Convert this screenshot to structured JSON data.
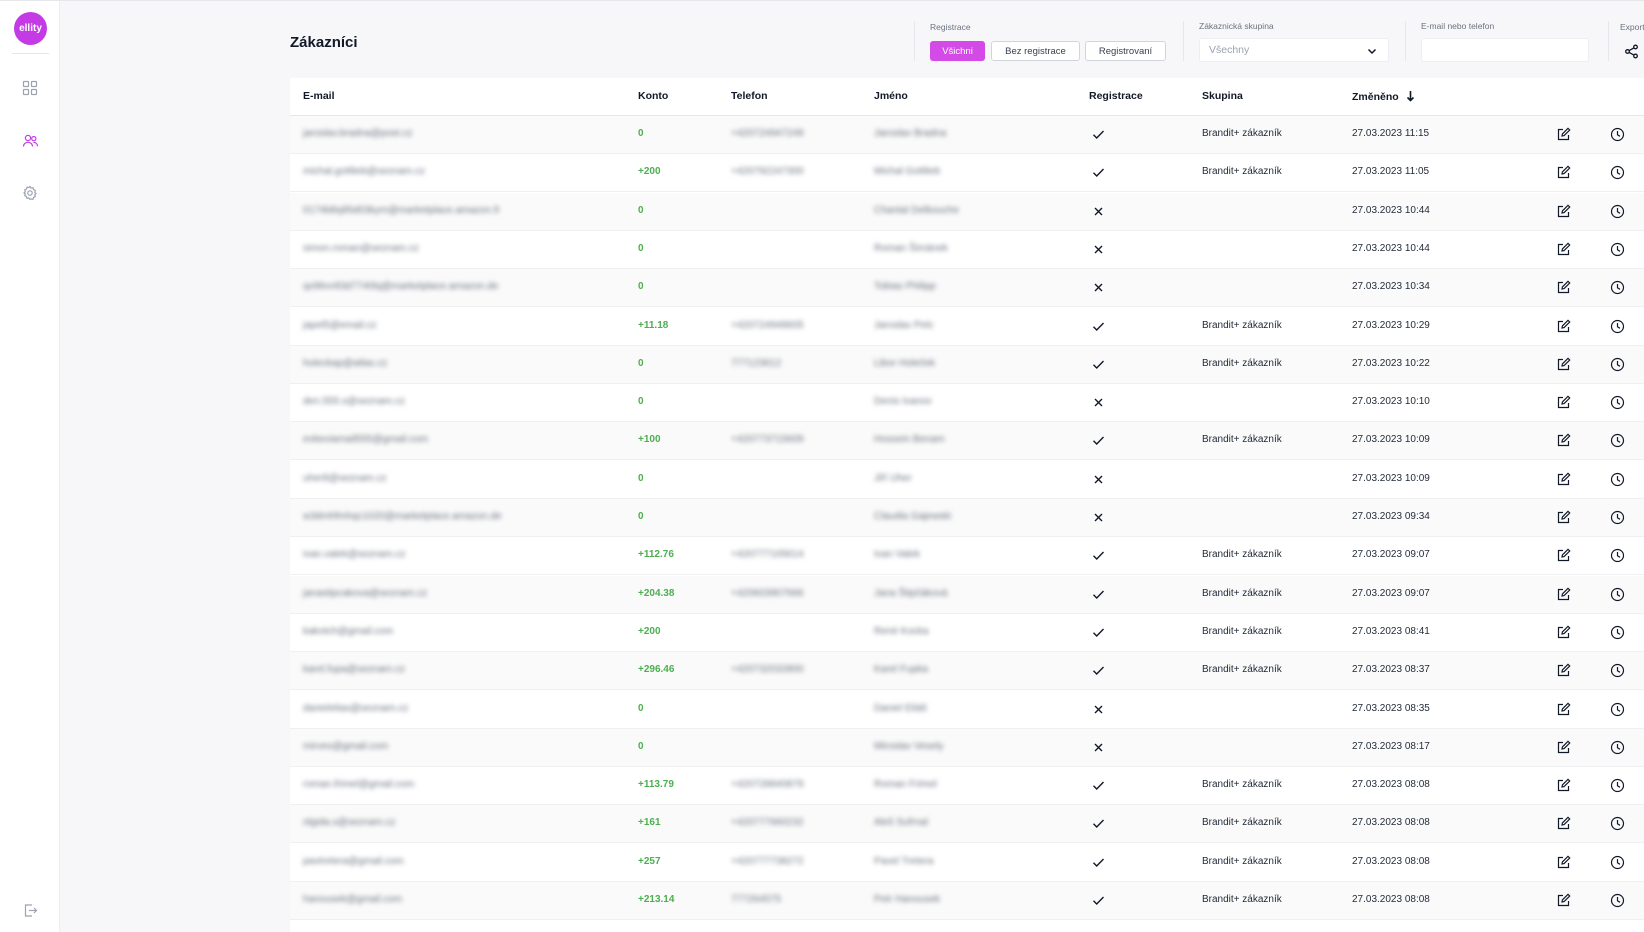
{
  "app": {
    "logo_text": "ellity",
    "accent": "#d44ae6"
  },
  "sidebar": {
    "items": [
      {
        "name": "dashboard",
        "icon": "grid-icon"
      },
      {
        "name": "customers",
        "icon": "users-icon",
        "active": true
      },
      {
        "name": "settings",
        "icon": "gear-icon"
      }
    ],
    "logout_icon": "logout-icon"
  },
  "header": {
    "title": "Zákazníci",
    "registration_filter": {
      "label": "Registrace",
      "options": [
        "Všichni",
        "Bez registrace",
        "Registrovaní"
      ],
      "selected": "Všichni"
    },
    "group_filter": {
      "label": "Zákaznická skupina",
      "selected": "Všechny"
    },
    "search": {
      "label": "E-mail nebo telefon",
      "value": ""
    },
    "export": {
      "label": "Export"
    }
  },
  "table": {
    "columns": [
      "E-mail",
      "Konto",
      "Telefon",
      "Jméno",
      "Registrace",
      "Skupina",
      "Změněno"
    ],
    "sort": {
      "column": "Změněno",
      "direction": "desc"
    },
    "rows": [
      {
        "email": "jaroslav.bradna@post.cz",
        "konto": "0",
        "telefon": "+420724947249",
        "jmeno": "Jaroslav Bradna",
        "registrace": true,
        "skupina": "Brandit+ zákazník",
        "zmeneno": "27.03.2023 11:15"
      },
      {
        "email": "michal.gottlieb@seznam.cz",
        "konto": "+200",
        "telefon": "+420792247300",
        "jmeno": "Michal Gottlieb",
        "registrace": true,
        "skupina": "Brandit+ zákazník",
        "zmeneno": "27.03.2023 11:05"
      },
      {
        "email": "0174b8q95d03kym@marketplace.amazon.fr",
        "konto": "0",
        "telefon": "",
        "jmeno": "Chantal Delbouche",
        "registrace": false,
        "skupina": "",
        "zmeneno": "27.03.2023 10:44"
      },
      {
        "email": "simon.roman@seznam.cz",
        "konto": "0",
        "telefon": "",
        "jmeno": "Roman Šimánek",
        "registrace": false,
        "skupina": "",
        "zmeneno": "27.03.2023 10:44"
      },
      {
        "email": "qx96vv93d7740lq@marketplace.amazon.de",
        "konto": "0",
        "telefon": "",
        "jmeno": "Tobias Philipp",
        "registrace": false,
        "skupina": "",
        "zmeneno": "27.03.2023 10:34"
      },
      {
        "email": "japel5@email.cz",
        "konto": "+11.18",
        "telefon": "+420724948605",
        "jmeno": "Jaroslav Pelc",
        "registrace": true,
        "skupina": "Brandit+ zákazník",
        "zmeneno": "27.03.2023 10:29"
      },
      {
        "email": "holeckap@atlas.cz",
        "konto": "0",
        "telefon": "777123612",
        "jmeno": "Libor Holeček",
        "registrace": true,
        "skupina": "Brandit+ zákazník",
        "zmeneno": "27.03.2023 10:22"
      },
      {
        "email": "den.555.s@seznam.cz",
        "konto": "0",
        "telefon": "",
        "jmeno": "Denis Ivanov",
        "registrace": false,
        "skupina": "",
        "zmeneno": "27.03.2023 10:10"
      },
      {
        "email": "evbeviamail555@gmail.com",
        "konto": "+100",
        "telefon": "+420773715609",
        "jmeno": "Hossein Benam",
        "registrace": true,
        "skupina": "Brandit+ zákazník",
        "zmeneno": "27.03.2023 10:09"
      },
      {
        "email": "uher8@seznam.cz",
        "konto": "0",
        "telefon": "",
        "jmeno": "Jiří Uher",
        "registrace": false,
        "skupina": "",
        "zmeneno": "27.03.2023 10:09"
      },
      {
        "email": "w3dmhfmhqc1020@marketplace.amazon.de",
        "konto": "0",
        "telefon": "",
        "jmeno": "Claudia Gajewski",
        "registrace": false,
        "skupina": "",
        "zmeneno": "27.03.2023 09:34"
      },
      {
        "email": "ivan.valek@seznam.cz",
        "konto": "+112.76",
        "telefon": "+420777105614",
        "jmeno": "Ivan Valek",
        "registrace": true,
        "skupina": "Brandit+ zákazník",
        "zmeneno": "27.03.2023 09:07"
      },
      {
        "email": "janastipcakova@seznam.cz",
        "konto": "+204.38",
        "telefon": "+420603907666",
        "jmeno": "Jana Štipčáková",
        "registrace": true,
        "skupina": "Brandit+ zákazník",
        "zmeneno": "27.03.2023 09:07"
      },
      {
        "email": "kakotch@gmail.com",
        "konto": "+200",
        "telefon": "",
        "jmeno": "René Kocka",
        "registrace": true,
        "skupina": "Brandit+ zákazník",
        "zmeneno": "27.03.2023 08:41"
      },
      {
        "email": "karel.fupa@seznam.cz",
        "konto": "+296.46",
        "telefon": "+420732032800",
        "jmeno": "Karel Fupka",
        "registrace": true,
        "skupina": "Brandit+ zákazník",
        "zmeneno": "27.03.2023 08:37"
      },
      {
        "email": "danielelias@seznam.cz",
        "konto": "0",
        "telefon": "",
        "jmeno": "Daniel Eliáš",
        "registrace": false,
        "skupina": "",
        "zmeneno": "27.03.2023 08:35"
      },
      {
        "email": "mirves@gmail.com",
        "konto": "0",
        "telefon": "",
        "jmeno": "Miroslav Vesely",
        "registrace": false,
        "skupina": "",
        "zmeneno": "27.03.2023 08:17"
      },
      {
        "email": "roman.frimel@gmail.com",
        "konto": "+113.79",
        "telefon": "+420728840879",
        "jmeno": "Roman Frimel",
        "registrace": true,
        "skupina": "Brandit+ zákazník",
        "zmeneno": "27.03.2023 08:08"
      },
      {
        "email": "olgida.s@seznam.cz",
        "konto": "+161",
        "telefon": "+420777660232",
        "jmeno": "Aleš Sufrnal",
        "registrace": true,
        "skupina": "Brandit+ zákazník",
        "zmeneno": "27.03.2023 08:08"
      },
      {
        "email": "pavtretera@gmail.com",
        "konto": "+257",
        "telefon": "+420777738272",
        "jmeno": "Pavel Tretera",
        "registrace": true,
        "skupina": "Brandit+ zákazník",
        "zmeneno": "27.03.2023 08:08"
      },
      {
        "email": "hanousek@gmail.com",
        "konto": "+213.14",
        "telefon": "777264575",
        "jmeno": "Petr Hanousek",
        "registrace": true,
        "skupina": "Brandit+ zákazník",
        "zmeneno": "27.03.2023 08:08"
      }
    ]
  }
}
